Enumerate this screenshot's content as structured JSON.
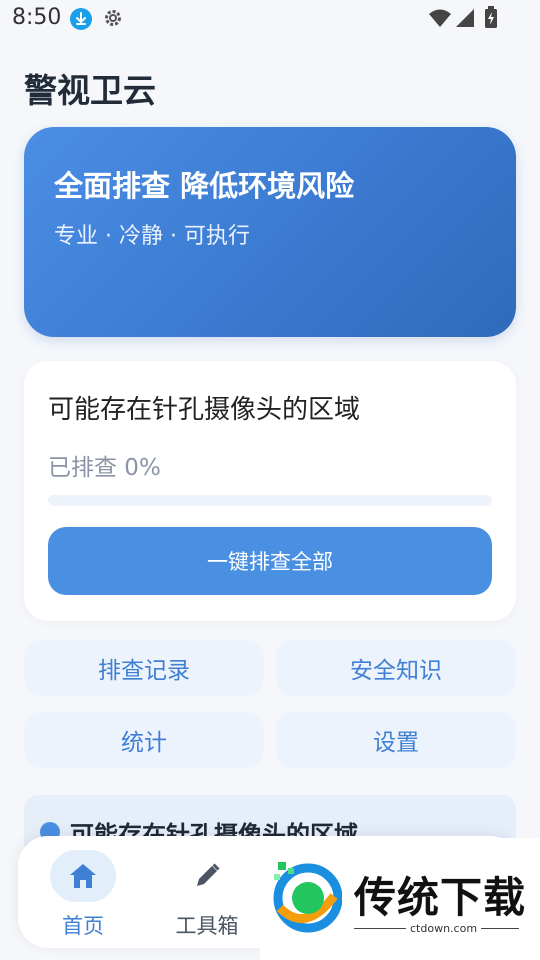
{
  "status_bar": {
    "time": "8:50",
    "icons": [
      "download-icon",
      "gear-icon",
      "wifi-icon",
      "signal-icon",
      "battery-icon"
    ]
  },
  "app": {
    "title": "警视卫云"
  },
  "hero": {
    "title": "全面排查 降低环境风险",
    "subtitle": "专业 · 冷静 · 可执行"
  },
  "scan_card": {
    "title": "可能存在针孔摄像头的区域",
    "progress_text": "已排查 0%",
    "progress_fraction": 0,
    "button_label": "一键排查全部"
  },
  "quick_actions": {
    "records": "排查记录",
    "knowledge": "安全知识",
    "stats": "统计",
    "settings": "设置"
  },
  "section": {
    "title": "可能存在针孔摄像头的区域"
  },
  "bottom_nav": {
    "items": [
      {
        "label": "首页",
        "icon": "home-icon",
        "active": true
      },
      {
        "label": "工具箱",
        "icon": "pencil-icon",
        "active": false
      }
    ]
  },
  "watermark": {
    "brand": "传统下载",
    "url": "ctdown.com"
  },
  "colors": {
    "accent": "#4a90e2",
    "hero_start": "#4b8ee6",
    "hero_end": "#2f6bba",
    "tile_bg": "#edf3fc"
  }
}
